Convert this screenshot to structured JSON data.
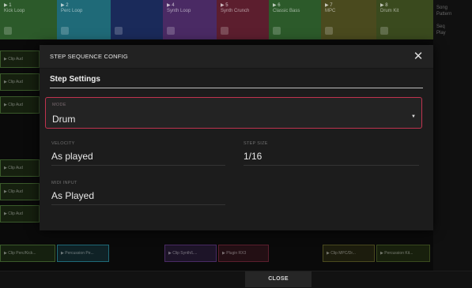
{
  "tracks": [
    {
      "num": "▶ 1",
      "name": "Kick Loop",
      "color": "#2c5a2a"
    },
    {
      "num": "▶ 2",
      "name": "Perc Loop",
      "color": "#1f6a78"
    },
    {
      "num": "",
      "name": "",
      "color": "#1a2a5a"
    },
    {
      "num": "▶ 4",
      "name": "Synth Loop",
      "color": "#4a2a64"
    },
    {
      "num": "▶ 5",
      "name": "Synth Crunch",
      "color": "#5c1e2e"
    },
    {
      "num": "▶ 6",
      "name": "Classic Bass",
      "color": "#2c5a2a"
    },
    {
      "num": "▶ 7",
      "name": "MPC",
      "color": "#4a4a1e"
    },
    {
      "num": "▶ 8",
      "name": "Drum Kit",
      "color": "#3a4a1e"
    }
  ],
  "rightside": {
    "line1": "Song",
    "line2": "Pattern",
    "line3": "Seq",
    "line4": "Play"
  },
  "clips_left": {
    "label": "▶ Clip Aud"
  },
  "clips_bottom": [
    "▶ Clip Perc/Kick...",
    "▶ Percussion Pe...",
    "▶ Clip Synth/L...",
    "▶ Plugin RX3",
    "▶ Clip MPC/Dr...",
    "▶ Percussion Kit..."
  ],
  "dialog": {
    "title": "STEP SEQUENCE CONFIG",
    "section_title": "Step Settings",
    "mode": {
      "label": "MODE",
      "value": "Drum"
    },
    "velocity": {
      "label": "VELOCITY",
      "value": "As played"
    },
    "step_size": {
      "label": "STEP SIZE",
      "value": "1/16"
    },
    "midi_input": {
      "label": "MIDI INPUT",
      "value": "As Played"
    }
  },
  "footer": {
    "close_label": "CLOSE"
  },
  "colors": {
    "accent": "#c0334f"
  }
}
